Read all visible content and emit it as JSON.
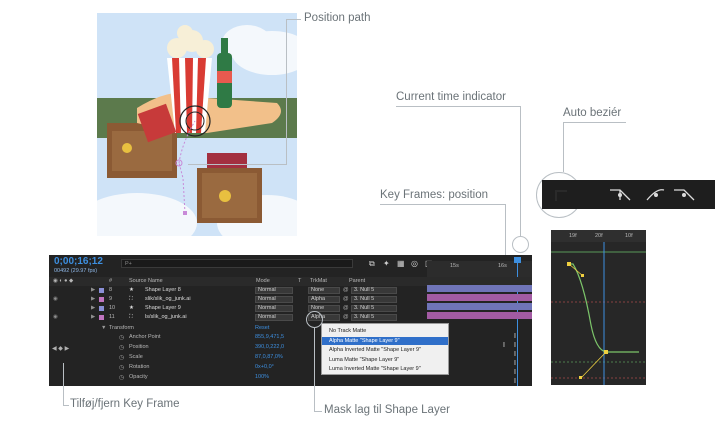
{
  "callouts": {
    "position_path": "Position path",
    "current_time_indicator": "Current time indicator",
    "auto_bezier": "Auto beziér",
    "key_frames_position": "Key Frames: position",
    "add_remove_key_frame": "Tilføj/fjern Key Frame",
    "mask_layer": "Mask lag til Shape Layer"
  },
  "timeline": {
    "timecode": "0;00;16;12",
    "fps": "00492 (29.97 fps)",
    "search_placeholder": "P+",
    "headers": {
      "number": "#",
      "source_name": "Source Name",
      "mode": "Mode",
      "t": "T",
      "trkmat": "TrkMat",
      "parent": "Parent"
    },
    "ruler": [
      "15s",
      "16s"
    ],
    "layers": [
      {
        "number": "8",
        "name": "Shape Layer 8",
        "mode": "Normal",
        "trkmat": "None",
        "parent": "3. Null 5",
        "color": "#8a8fd6"
      },
      {
        "number": "9",
        "name": "slik/slik_og_junk.ai",
        "mode": "Normal",
        "trkmat": "Alpha",
        "parent": "3. Null 5",
        "color": "#c074c0"
      },
      {
        "number": "10",
        "name": "Shape Layer 9",
        "mode": "Normal",
        "trkmat": "None",
        "parent": "3. Null 5",
        "color": "#8a8fd6"
      },
      {
        "number": "11",
        "name": "ls/slik_og_junk.ai",
        "mode": "Normal",
        "trkmat": "Alpha",
        "parent": "3. Null 5",
        "color": "#c074c0"
      }
    ],
    "transform": {
      "label": "Transform",
      "reset": "Reset",
      "properties": [
        {
          "name": "Anchor Point",
          "value": "855,9,471,5"
        },
        {
          "name": "Position",
          "value": "390,0,222,0"
        },
        {
          "name": "Scale",
          "value": "87,0,87,0%"
        },
        {
          "name": "Rotation",
          "value": "0x+0,0°"
        },
        {
          "name": "Opacity",
          "value": "100%"
        }
      ]
    }
  },
  "matte_menu": {
    "items": [
      "No Track Matte",
      "Alpha Matte \"Shape Layer 9\"",
      "Alpha Inverted Matte \"Shape Layer 9\"",
      "Luma Matte \"Shape Layer 9\"",
      "Luma Inverted Matte \"Shape Layer 9\""
    ],
    "selected_index": 1
  },
  "graph": {
    "ruler": [
      "19f",
      "20f",
      "10f"
    ]
  },
  "colors": {
    "panel": "#232323",
    "timecode": "#3d8fe0",
    "menu_selected": "#2f6fc9",
    "keyframe": "#f0d040"
  }
}
